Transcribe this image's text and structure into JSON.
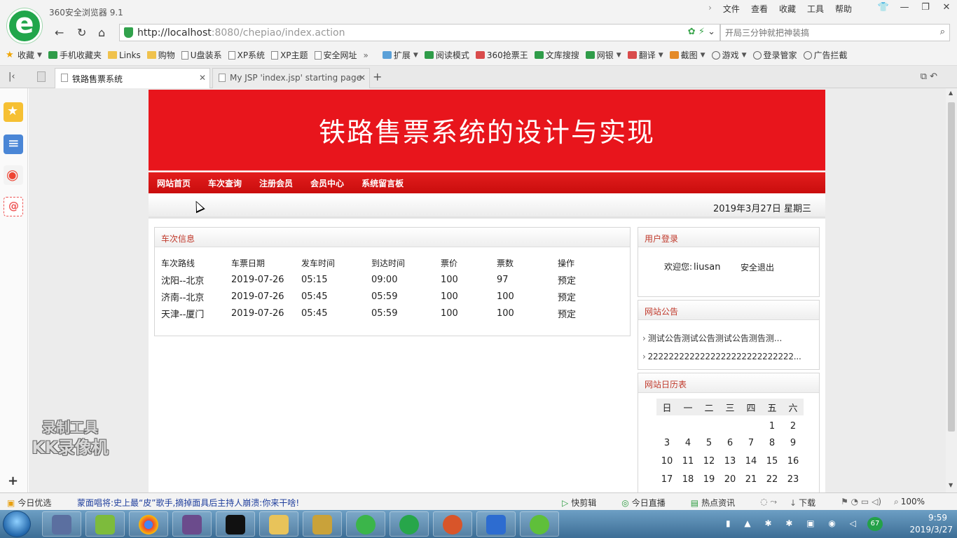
{
  "browser": {
    "name": "360安全浏览器 9.1",
    "menu": [
      "文件",
      "查看",
      "收藏",
      "工具",
      "帮助"
    ],
    "url_host": "http://localhost",
    "url_path": ":8080/chepiao/index.action",
    "search_placeholder": "开局三分钟就把神装搞",
    "bookmarks": [
      "收藏",
      "手机收藏夹",
      "Links",
      "购物",
      "U盘装系",
      "XP系统",
      "XP主题",
      "安全网址"
    ],
    "extensions": [
      "扩展",
      "阅读模式",
      "360抢票王",
      "文库搜搜",
      "网银",
      "翻译",
      "截图",
      "游戏",
      "登录管家",
      "广告拦截"
    ],
    "tabs": [
      {
        "label": "铁路售票系统"
      },
      {
        "label": "My JSP 'index.jsp' starting page"
      }
    ]
  },
  "site": {
    "title": "铁路售票系统的设计与实现",
    "nav": [
      "网站首页",
      "车次查询",
      "注册会员",
      "会员中心",
      "系统留言板"
    ],
    "date": "2019年3月27日 星期三"
  },
  "trains": {
    "heading": "车次信息",
    "columns": [
      "车次路线",
      "车票日期",
      "发车时间",
      "到达时间",
      "票价",
      "票数",
      "操作"
    ],
    "rows": [
      [
        "沈阳--北京",
        "2019-07-26",
        "05:15",
        "09:00",
        "100",
        "97",
        "预定"
      ],
      [
        "济南--北京",
        "2019-07-26",
        "05:45",
        "05:59",
        "100",
        "100",
        "预定"
      ],
      [
        "天津--厦门",
        "2019-07-26",
        "05:45",
        "05:59",
        "100",
        "100",
        "预定"
      ]
    ]
  },
  "login": {
    "heading": "用户登录",
    "welcome": "欢迎您:",
    "username": "liusan",
    "logout": "安全退出"
  },
  "notices": {
    "heading": "网站公告",
    "items": [
      "测试公告测试公告测试公告测告测...",
      "2222222222222222222222222222..."
    ]
  },
  "calendar": {
    "heading": "网站日历表",
    "weekdays": [
      "日",
      "一",
      "二",
      "三",
      "四",
      "五",
      "六"
    ],
    "weeks": [
      [
        "",
        "",
        "",
        "",
        "",
        "1",
        "2"
      ],
      [
        "3",
        "4",
        "5",
        "6",
        "7",
        "8",
        "9"
      ],
      [
        "10",
        "11",
        "12",
        "13",
        "14",
        "15",
        "16"
      ],
      [
        "17",
        "18",
        "19",
        "20",
        "21",
        "22",
        "23"
      ]
    ]
  },
  "watermark": {
    "line1": "录制工具",
    "line2": "KK录像机"
  },
  "statusbar": {
    "left": "今日优选",
    "news": "蒙面唱将:史上最“皮”歌手,摘掉面具后主持人崩溃:你来干啥!",
    "right": [
      "快剪辑",
      "今日直播",
      "热点资讯",
      "下载",
      "100%"
    ]
  },
  "taskbar": {
    "time": "9:59",
    "date": "2019/3/27",
    "badge": "67"
  },
  "colors": {
    "banner": "#e8151c",
    "nav": "#cc1010",
    "panel_heading": "#c0392b"
  }
}
